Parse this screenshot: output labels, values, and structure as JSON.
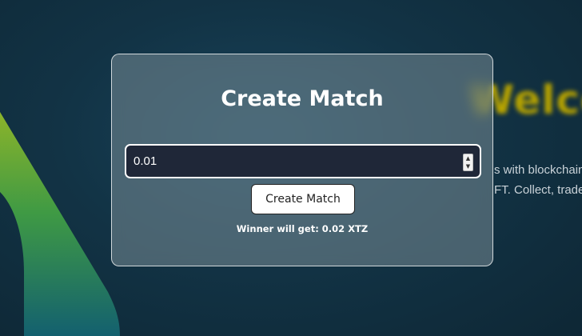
{
  "background": {
    "welcome_text": "Welco",
    "tagline_line1": "s with blockchain",
    "tagline_line2": "FT. Collect, trade"
  },
  "modal": {
    "title": "Create Match",
    "amount_value": "0.01",
    "create_button_label": "Create Match",
    "winner_text": "Winner will get: 0.02 XTZ"
  },
  "colors": {
    "accent_gold": "#b8a400",
    "input_bg": "#1f2738",
    "swoosh_green": "#7aa52a",
    "swoosh_teal": "#1a6b78"
  },
  "icons": {
    "spinner_up": "chevron-up-icon",
    "spinner_down": "chevron-down-icon"
  }
}
